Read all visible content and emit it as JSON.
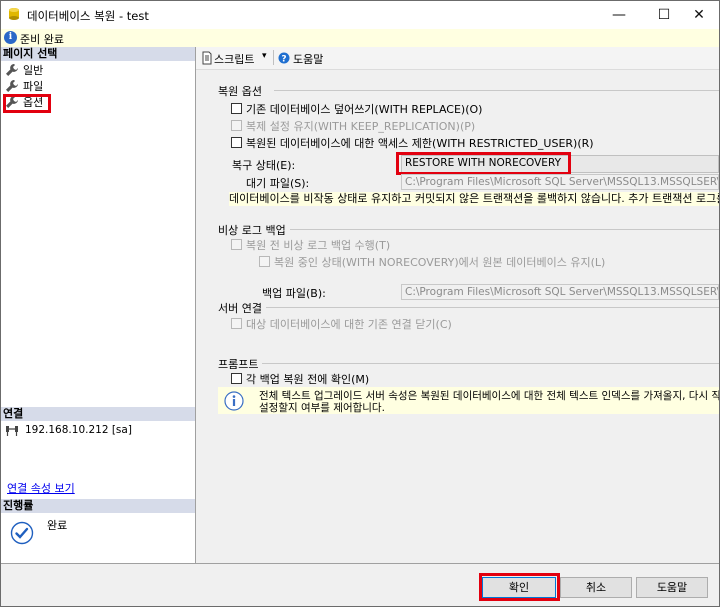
{
  "window": {
    "title": "데이터베이스 복원 - test",
    "minimize": "—",
    "maximize": "☐",
    "close": "✕"
  },
  "status": {
    "text": "준비 완료"
  },
  "left": {
    "page_select_header": "페이지 선택",
    "pages": [
      {
        "label": "일반"
      },
      {
        "label": "파일"
      },
      {
        "label": "옵션"
      }
    ],
    "connection_header": "연결",
    "connection_server": "192.168.10.212 [sa]",
    "connection_props_link": "연결 속성 보기",
    "progress_header": "진행률",
    "progress_status": "완료"
  },
  "toolbar": {
    "script_label": "스크립트",
    "script_arrow": "▾",
    "help_label": "도움말"
  },
  "restore_options": {
    "header": "복원 옵션",
    "overwrite": "기존 데이터베이스 덮어쓰기(WITH REPLACE)(O)",
    "keep_replication": "복제 설정 유지(WITH KEEP_REPLICATION)(P)",
    "restricted_user": "복원된 데이터베이스에 대한 액세스 제한(WITH RESTRICTED_USER)(R)",
    "recovery_state_label": "복구 상태(E):",
    "recovery_state_value": "RESTORE WITH NORECOVERY",
    "standby_label": "대기 파일(S):",
    "standby_path": "C:\\Program Files\\Microsoft SQL Server\\MSSQL13.MSSQLSERVER\\MSSQL\\Backup\\test_RollbackUndo.bak",
    "recovery_desc": "데이터베이스를 비작동 상태로 유지하고 커밋되지 않은 트랜잭션을 롤백하지 않습니다. 추가 트랜잭션 로그를 복원할 수 있습니다."
  },
  "tail_log": {
    "header": "비상 로그 백업",
    "take_backup": "복원 전 비상 로그 백업 수행(T)",
    "leave_norecovery": "복원 중인 상태(WITH NORECOVERY)에서 원본 데이터베이스 유지(L)",
    "backup_file_label": "백업 파일(B):",
    "backup_file_path": "C:\\Program Files\\Microsoft SQL Server\\MSSQL13.MSSQLSERVER\\MSSQL\\Backup\\test_LogBackup.bak"
  },
  "server_conn": {
    "header": "서버 연결",
    "close_existing": "대상 데이터베이스에 대한 기존 연결 닫기(C)"
  },
  "prompt": {
    "header": "프롬프트",
    "confirm_each": "각 백업 복원 전에 확인(M)",
    "info_line1": "전체 텍스트 업그레이드 서버 속성은 복원된 데이터베이스에 대한 전체 텍스트 인덱스를 가져올지, 다시 작성할지,",
    "info_line2": "설정할지 여부를 제어합니다."
  },
  "footer": {
    "ok": "확인",
    "cancel": "취소",
    "help": "도움말"
  },
  "colors": {
    "highlight": "#e2000f",
    "section_header": "#d6dbe9",
    "info_bg": "#ffffe1",
    "link": "#0000ee"
  }
}
